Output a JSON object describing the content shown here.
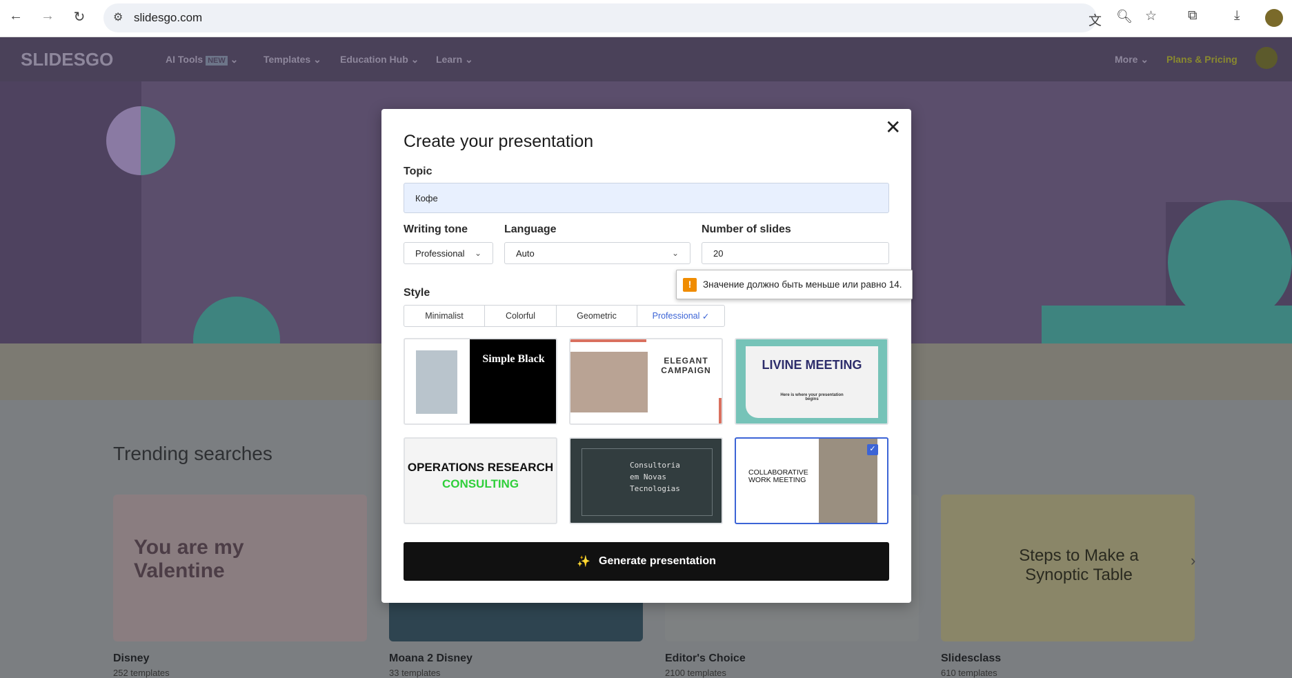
{
  "browser": {
    "url": "slidesgo.com"
  },
  "nav": {
    "logo": "SLIDESGO",
    "items": [
      {
        "label": "AI Tools",
        "badge": "NEW"
      },
      {
        "label": "Templates"
      },
      {
        "label": "Education Hub"
      },
      {
        "label": "Learn"
      }
    ],
    "more": "More",
    "pricing": "Plans & Pricing"
  },
  "page": {
    "trending_title": "Trending searches",
    "cards": [
      {
        "title": "Disney",
        "count": "252 templates",
        "thumb_text": "You are my Valentine"
      },
      {
        "title": "Moana 2 Disney",
        "count": "33 templates"
      },
      {
        "title": "Editor's Choice",
        "count": "2100 templates"
      },
      {
        "title": "Slidesclass",
        "count": "610 templates",
        "thumb_text": "Steps to Make a Synoptic Table"
      }
    ]
  },
  "modal": {
    "title": "Create your presentation",
    "topic_label": "Topic",
    "topic_value": "Кофе",
    "tone_label": "Writing tone",
    "tone_value": "Professional",
    "language_label": "Language",
    "language_value": "Auto",
    "slides_label": "Number of slides",
    "slides_value": "20",
    "validation_message": "Значение должно быть меньше или равно 14.",
    "style_label": "Style",
    "styles": [
      "Minimalist",
      "Colorful",
      "Geometric",
      "Professional"
    ],
    "selected_style": "Professional",
    "templates": [
      {
        "name": "Simple Black"
      },
      {
        "name": "ELEGANT CAMPAIGN"
      },
      {
        "name": "LIVINE MEETING",
        "sub": "Here is where your presentation begins"
      },
      {
        "name": "OPERATIONS RESEARCH",
        "name2": "CONSULTING"
      },
      {
        "name": "Consultoria em Novas Tecnologias"
      },
      {
        "name": "COLLABORATIVE WORK MEETING",
        "selected": true
      }
    ],
    "generate_label": "Generate presentation"
  },
  "colors": {
    "accent": "#3c64d6",
    "pricing": "#8a8a2e",
    "warning": "#f08c00"
  }
}
